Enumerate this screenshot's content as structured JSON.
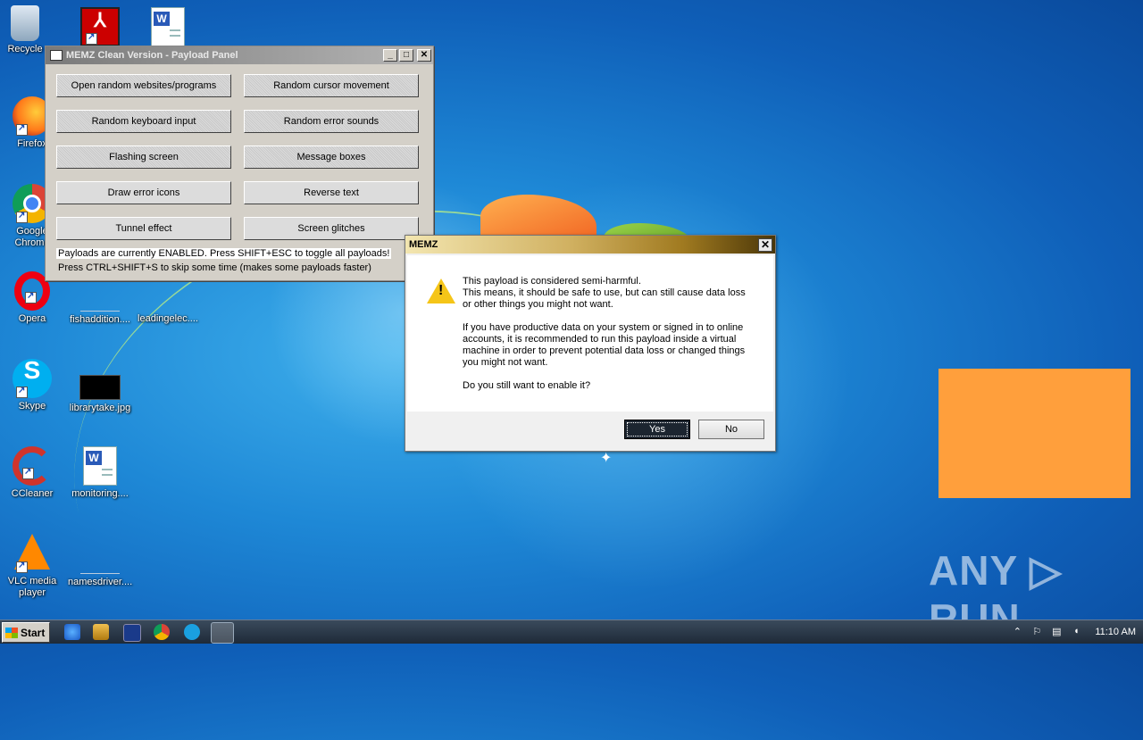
{
  "desktop": {
    "icons": [
      {
        "label": "Recycle",
        "icon": "recycle-bin-icon"
      },
      {
        "label": "",
        "icon": "pdf-icon"
      },
      {
        "label": "",
        "icon": "word-document-icon"
      },
      {
        "label": "Firefox",
        "icon": "firefox-icon"
      },
      {
        "label": "Google Chrome",
        "icon": "chrome-icon"
      },
      {
        "label": "Opera",
        "icon": "opera-icon"
      },
      {
        "label": "fishaddition....",
        "icon": "file-icon"
      },
      {
        "label": "leadingelec....",
        "icon": "word-document-icon"
      },
      {
        "label": "Skype",
        "icon": "skype-icon"
      },
      {
        "label": "librarytake.jpg",
        "icon": "image-file-icon"
      },
      {
        "label": "CCleaner",
        "icon": "ccleaner-icon"
      },
      {
        "label": "monitoring....",
        "icon": "word-document-icon"
      },
      {
        "label": "VLC media player",
        "icon": "vlc-icon"
      },
      {
        "label": "namesdriver....",
        "icon": "file-icon"
      }
    ]
  },
  "panel": {
    "title": "MEMZ Clean Version - Payload Panel",
    "buttons": [
      "Open random websites/programs",
      "Random cursor movement",
      "Random keyboard input",
      "Random error sounds",
      "Flashing screen",
      "Message boxes",
      "Draw error icons",
      "Reverse text",
      "Tunnel effect",
      "Screen glitches"
    ],
    "status1": "Payloads are currently ENABLED. Press SHIFT+ESC to toggle all payloads!",
    "status2": "Press CTRL+SHIFT+S to skip some time (makes some payloads faster)"
  },
  "dialog": {
    "title": "MEMZ",
    "p1": "This payload is considered semi-harmful.\nThis means, it should be safe to use, but can still cause data loss\nor other things you might not want.",
    "p2": "If you have productive data on your system or signed in to online\naccounts, it is recommended to run this payload inside a virtual\nmachine in order to prevent potential data loss or changed things\nyou might not want.",
    "p3": "Do you still want to enable it?",
    "yes": "Yes",
    "no": "No"
  },
  "taskbar": {
    "start": "Start",
    "clock": "11:10 AM"
  },
  "watermark": "ANY ▷ RUN",
  "colors": {
    "desktop": "#1e88d6",
    "orange_box": "#ff9f3c",
    "yes_button": "#1c2530"
  }
}
